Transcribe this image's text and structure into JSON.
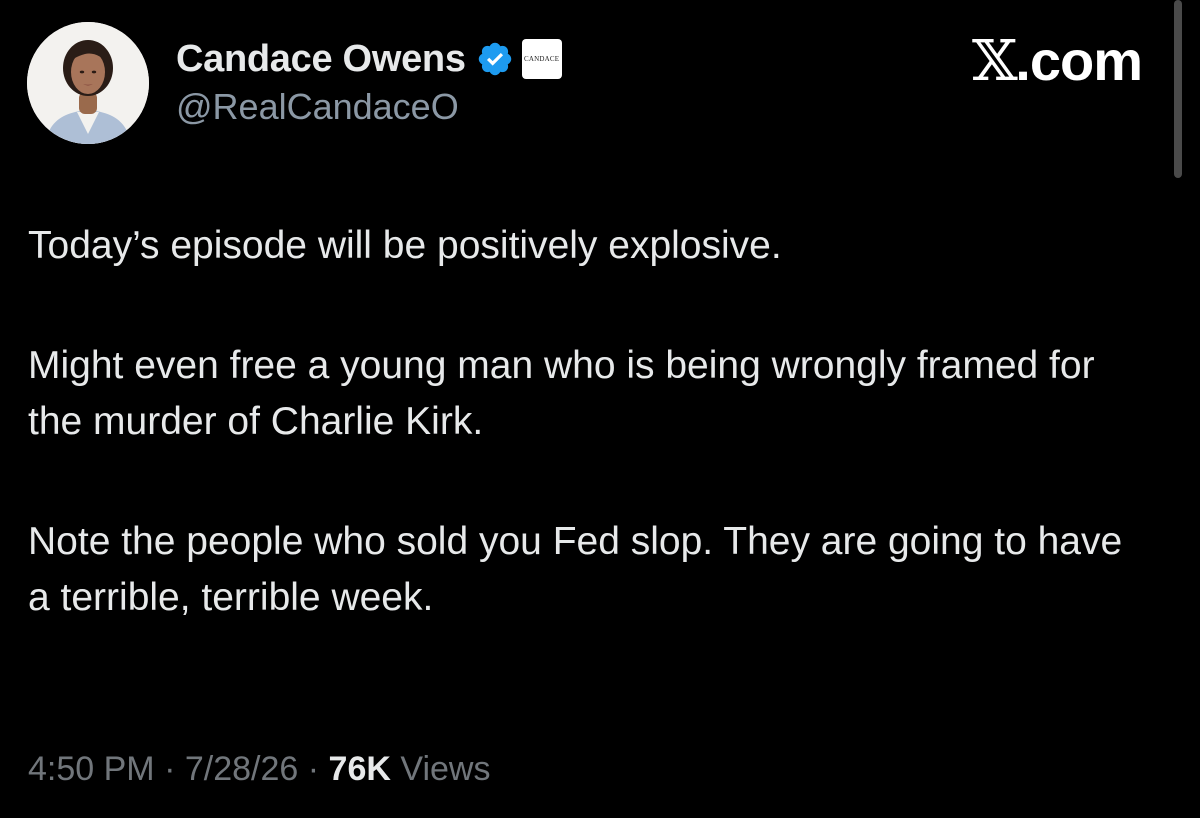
{
  "author": {
    "display_name": "Candace Owens",
    "handle": "@RealCandaceO",
    "verified_icon": "verified-badge-icon",
    "affiliate_badge_text": "CANDACE",
    "verified_color": "#1d9bf0"
  },
  "brand": {
    "text": ".com",
    "logo_letter": "𝕏"
  },
  "tweet": {
    "paragraphs": [
      "Today’s episode will be positively explosive.",
      "Might even free a young man who is being wrongly framed for the murder of Charlie Kirk.",
      "Note the people who sold you Fed slop. They are going to have a terrible, terrible week."
    ]
  },
  "meta": {
    "time": "4:50 PM",
    "separator": "·",
    "date": "7/28/26",
    "views_count": "76K",
    "views_label": "Views"
  },
  "colors": {
    "background": "#000000",
    "primary_text": "#e7e9ea",
    "secondary_text": "#71767b",
    "handle_text": "#8b98a5"
  }
}
